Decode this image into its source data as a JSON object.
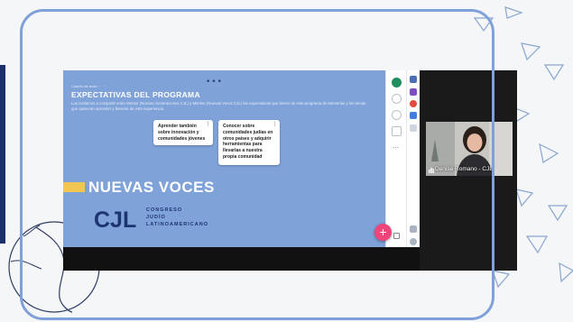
{
  "slide": {
    "top_dots": "•••",
    "small_label": "Cuadro de texto · · · ·",
    "title": "EXPECTATIVAS DEL PROGRAMA",
    "description": "Los invitamos a compartir entre Mentor (Nuevas Generaciones CJL) y Mentee (Nuevas Voces CJL) las expectativas que tienen de este programa de Mentorías y los temas que quisieran aprender y llevarse de esta experiencia.",
    "notes": [
      {
        "text": "Aprender también sobre innovación y comunidades jóvenes"
      },
      {
        "text": "Conocer sobre comunidades judías en otros países y adquirir herramientas para llevarlas a nuestra propia comunidad"
      }
    ],
    "note_menu_glyph": "⋮",
    "banner": "NUEVAS VOCES",
    "logo_letters": "CJL",
    "logo_text": [
      "CONGRESO",
      "JUDÍO",
      "LATINOAMERICANO"
    ]
  },
  "rail": {
    "more_glyph": "⋯"
  },
  "fab": {
    "label": "+"
  },
  "video": {
    "participant_name": "Denise Romano - CJL"
  },
  "colors": {
    "slide_bg": "#7fa2d9",
    "accent_yellow": "#f3c654",
    "fab_pink": "#f0457a",
    "frame_blue": "#7fa0d8"
  }
}
